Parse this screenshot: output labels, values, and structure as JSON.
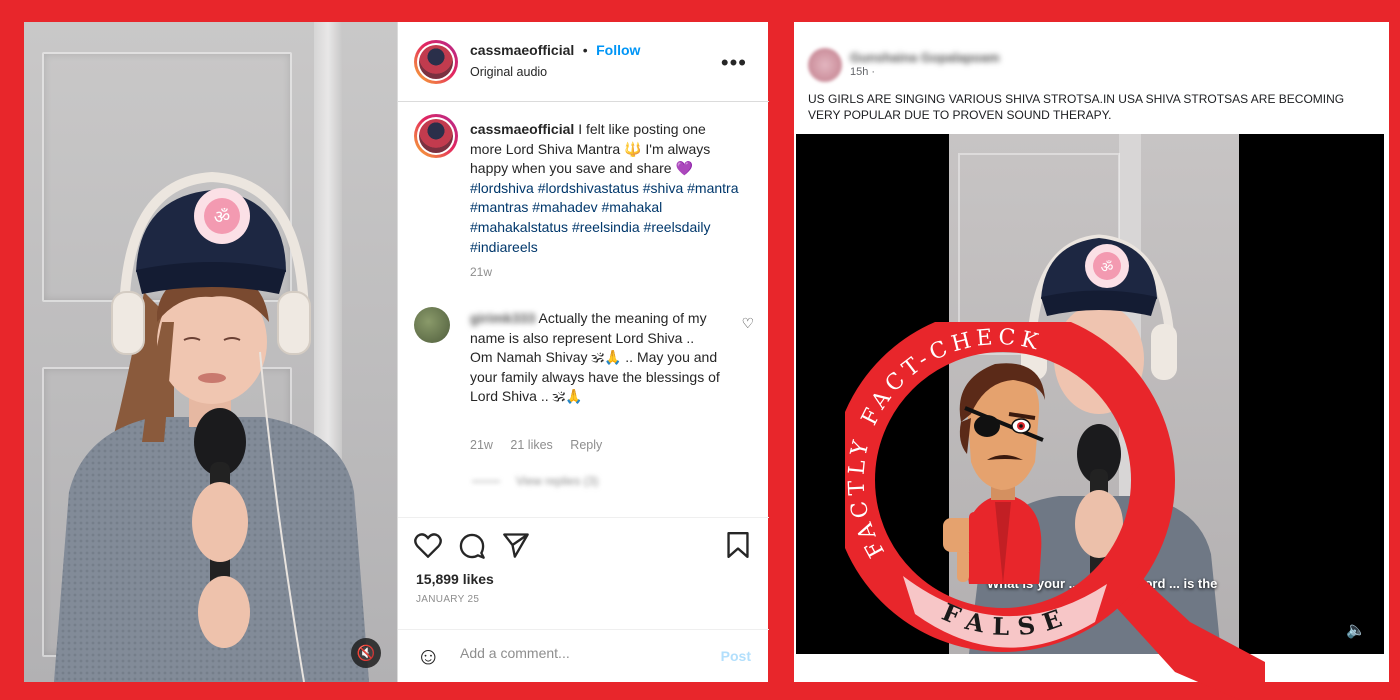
{
  "instagram": {
    "username": "cassmaeofficial",
    "separator": "•",
    "follow_label": "Follow",
    "audio": "Original audio",
    "more_icon": "more-horizontal-icon",
    "caption_user": "cassmaeofficial",
    "caption_text": "I felt like posting one more Lord Shiva Mantra 🔱 I'm always happy when you save and share 💜",
    "hashtags": "#lordshiva #lordshivastatus #shiva #mantra #mantras #mahadev #mahakal #mahakalstatus #reelsindia #reelsdaily #indiareels",
    "caption_time": "21w",
    "comment": {
      "user": "girimk333",
      "text": "Actually the meaning of my name is also represent Lord Shiva .. Om Namah Shivay 🕉🙏 .. May you and your family always have the blessings of Lord Shiva .. 🕉🙏",
      "time": "21w",
      "likes": "21 likes",
      "reply_label": "Reply",
      "view_replies": "View replies (3)"
    },
    "likes": "15,899 likes",
    "date": "JANUARY 25",
    "comment_placeholder": "Add a comment...",
    "post_label": "Post"
  },
  "facebook": {
    "name": "Gunshaina Gopalapoam",
    "time": "15h ·",
    "text": "US GIRLS ARE SINGING VARIOUS SHIVA STROTSA.IN USA SHIVA STROTSAS ARE BECOMING VERY POPULAR DUE TO PROVEN SOUND THERAPY.",
    "video_caption": "What is your ... name of Lord ... is the"
  },
  "stamp": {
    "arc_text": "FACTLY FACT-CHECK",
    "verdict": "FALSE"
  },
  "colors": {
    "frame_red": "#e8262b",
    "instagram_blue": "#0095f6",
    "stamp_pink": "#f7c6c7"
  }
}
